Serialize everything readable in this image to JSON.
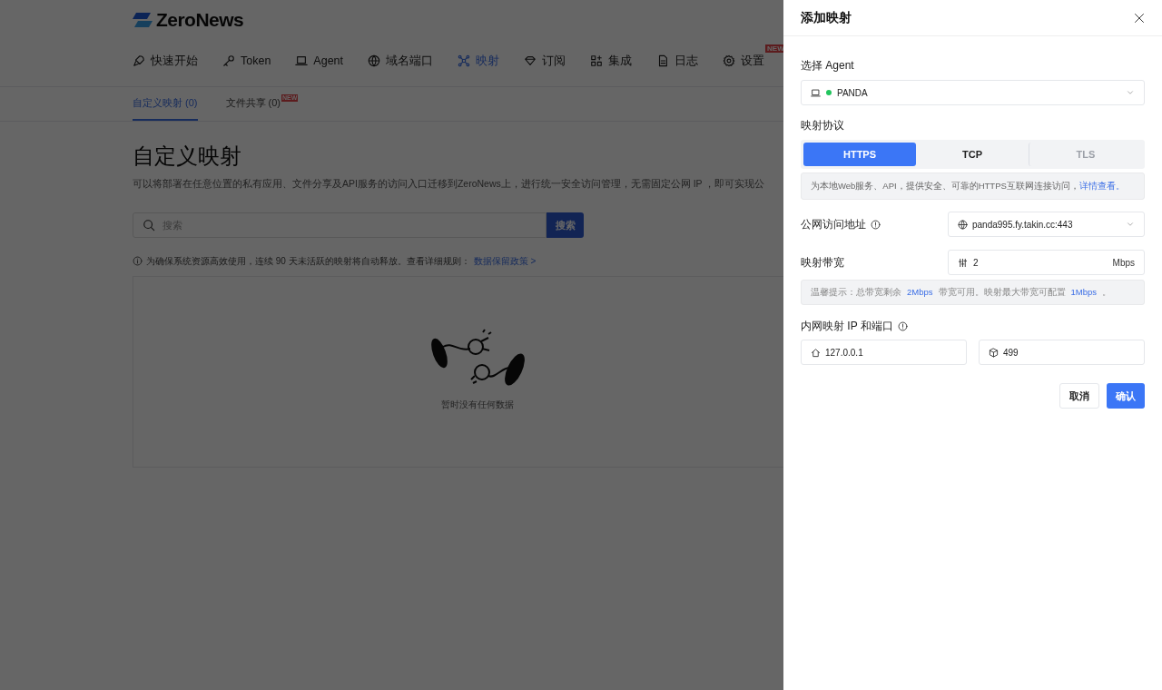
{
  "header": {
    "logo": "ZeroNews",
    "nav": [
      {
        "label": "快速开始",
        "selected": false
      },
      {
        "label": "Token",
        "selected": false
      },
      {
        "label": "Agent",
        "selected": false
      },
      {
        "label": "域名端口",
        "selected": false
      },
      {
        "label": "映射",
        "selected": true
      },
      {
        "label": "订阅",
        "selected": false
      },
      {
        "label": "集成",
        "selected": false
      },
      {
        "label": "日志",
        "selected": false
      },
      {
        "label": "设置",
        "selected": false,
        "badge": "NEW"
      }
    ]
  },
  "subtabs": [
    {
      "label": "自定义映射 (0)",
      "selected": true
    },
    {
      "label": "文件共享 (0)",
      "selected": false,
      "badge": "NEW"
    }
  ],
  "page": {
    "title": "自定义映射",
    "description": "可以将部署在任意位置的私有应用、文件分享及API服务的访问入口迁移到ZeroNews上，进行统一安全访问管理，无需固定公网 IP ，即可实现公",
    "search": {
      "placeholder": "搜索",
      "button": "搜索"
    },
    "notice": {
      "text": "为确保系统资源高效使用，连续 90 天未活跃的映射将自动释放。查看详细规则：",
      "link": "数据保留政策 >"
    },
    "empty_text": "暂时没有任何数据"
  },
  "drawer": {
    "title": "添加映射",
    "agent": {
      "label": "选择 Agent",
      "value": "PANDA",
      "color": "#22c55e"
    },
    "protocol": {
      "label": "映射协议",
      "options": [
        {
          "label": "HTTPS",
          "selected": true,
          "disabled": false
        },
        {
          "label": "TCP",
          "selected": false,
          "disabled": false
        },
        {
          "label": "TLS",
          "selected": false,
          "disabled": true
        }
      ],
      "hint": "为本地Web服务、API，提供安全、可靠的HTTPS互联网连接访问，",
      "hint_link": "详情查看。"
    },
    "address": {
      "label": "公网访问地址",
      "value": "panda995.fy.takin.cc:443"
    },
    "bandwidth": {
      "label": "映射带宽",
      "value": "2",
      "unit": "Mbps",
      "tip_parts": [
        "温馨提示：总带宽剩余",
        "2Mbps",
        "带宽可用。映射最大带宽可配置",
        "1Mbps",
        "。"
      ]
    },
    "internal": {
      "label": "内网映射 IP 和端口",
      "ip": "127.0.0.1",
      "port": "499"
    },
    "buttons": {
      "cancel": "取消",
      "confirm": "确认"
    }
  }
}
